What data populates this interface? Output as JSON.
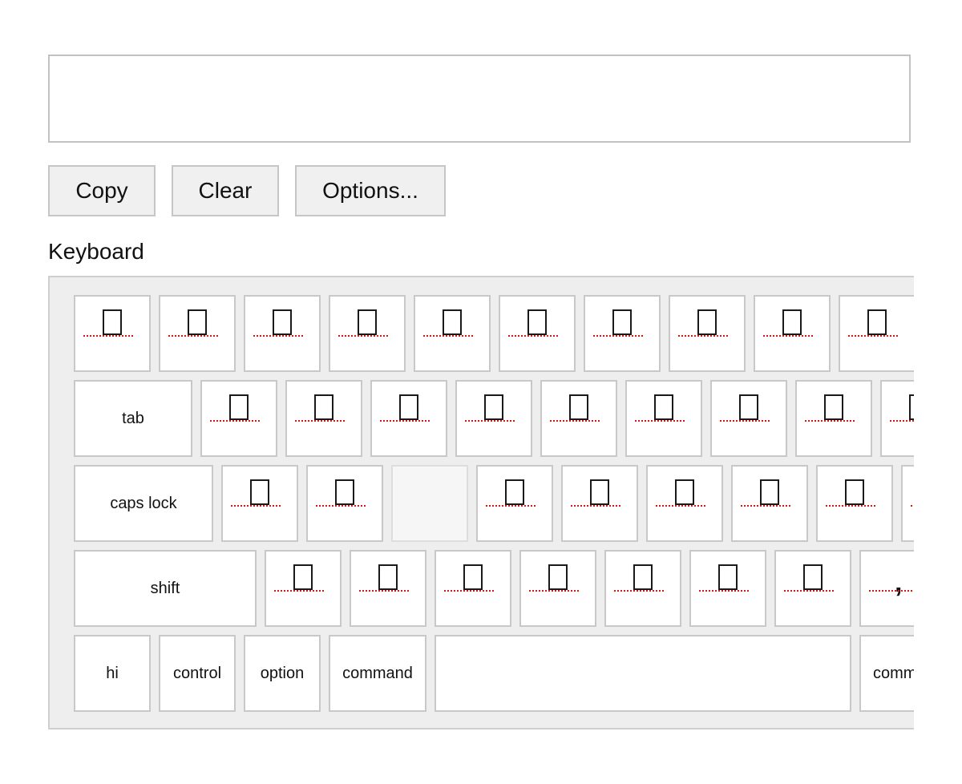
{
  "output": {
    "value": "",
    "placeholder": ""
  },
  "buttons": {
    "copy": "Copy",
    "clear": "Clear",
    "options": "Options..."
  },
  "keyboard_label": "Keyboard",
  "keys": {
    "tab": "tab",
    "caps_lock": "caps lock",
    "shift": "shift",
    "hi": "hi",
    "control": "control",
    "option": "option",
    "command_left": "command",
    "command_right": "comm",
    "comma": ","
  },
  "glyph_icon": "missing-glyph-box-icon",
  "colors": {
    "key_border": "#c8c8c8",
    "keyboard_bg": "#eeeeee",
    "dotted_underline": "#d11a1a",
    "button_bg": "#f0f0f0"
  }
}
